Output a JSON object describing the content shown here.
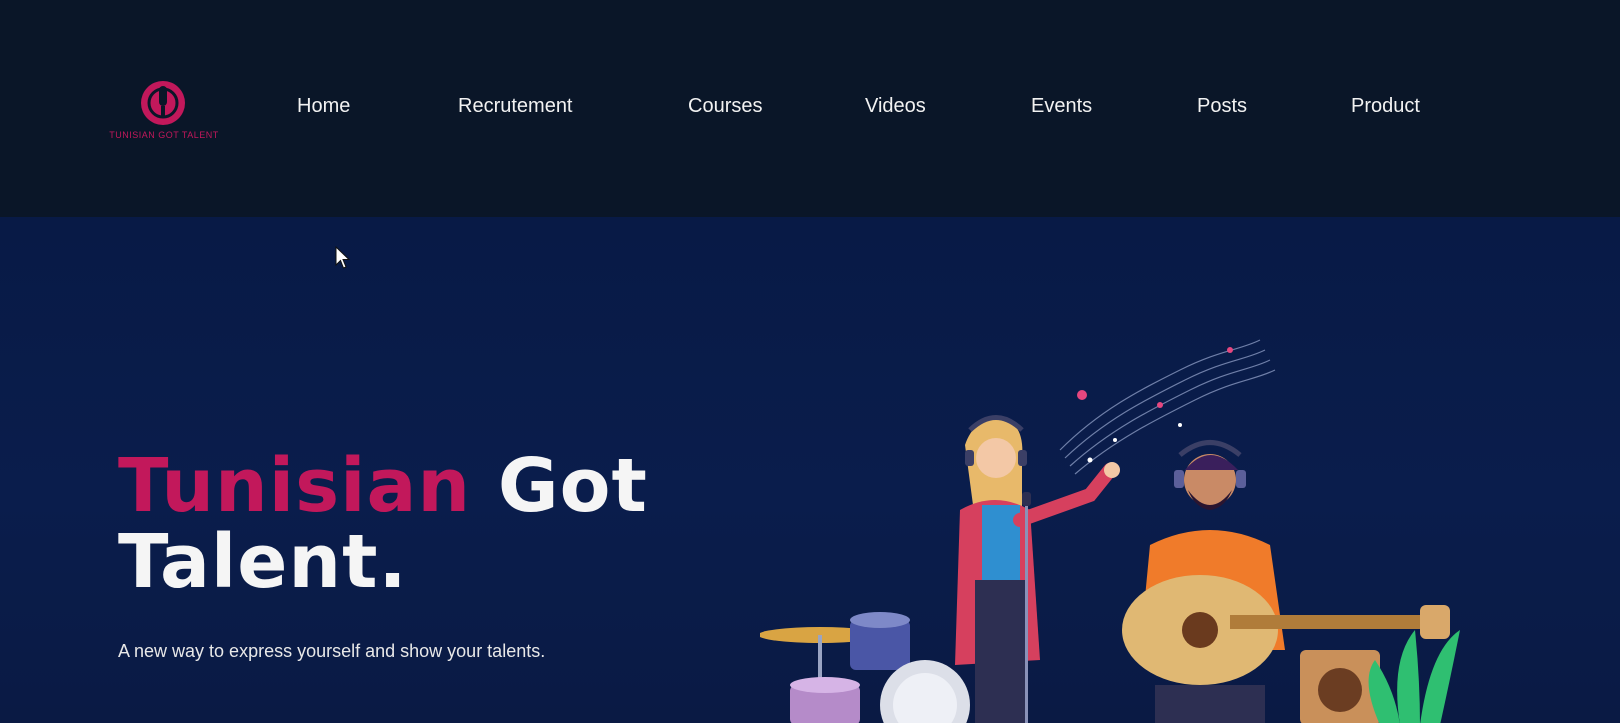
{
  "brand": {
    "logo_text": "TUNISIAN GOT TALENT",
    "accent_color": "#c2185b"
  },
  "nav": {
    "items": [
      {
        "label": "Home"
      },
      {
        "label": "Recrutement"
      },
      {
        "label": "Courses"
      },
      {
        "label": "Videos"
      },
      {
        "label": "Events"
      },
      {
        "label": "Posts"
      },
      {
        "label": "Product"
      }
    ]
  },
  "hero": {
    "title_highlight": "Tunisian",
    "title_rest_line1": "Got",
    "title_line2": "Talent.",
    "subtitle": "A new way to express yourself and show your talents.",
    "illustration": "band-musicians-illustration"
  },
  "icons": {
    "cursor": "mouse-pointer-icon",
    "logo": "microphone-logo-icon"
  }
}
